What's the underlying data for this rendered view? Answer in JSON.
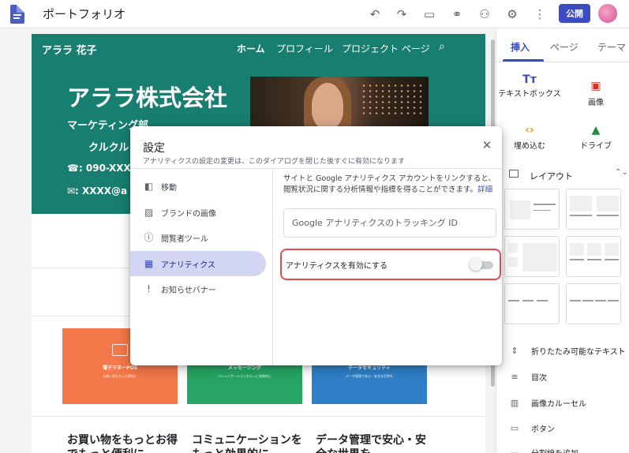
{
  "topbar": {
    "title": "ポートフォリオ",
    "icons": [
      "undo-icon",
      "redo-icon",
      "preview-icon",
      "link-icon",
      "share-icon",
      "gear-icon",
      "more-icon"
    ],
    "publish_label": "公開"
  },
  "site": {
    "name": "アララ 花子",
    "nav": [
      "ホーム",
      "プロフィール",
      "プロジェクト ページ"
    ],
    "company": "アララ株式会社",
    "department": "マーケティング部",
    "person": "クルクル",
    "tel": "☎: 090-XXX",
    "mail": "✉: XXXX@a",
    "cards": [
      {
        "title": "電子マネーPOS",
        "sub": "お買い物をもっと便利に"
      },
      {
        "title": "メッセージング",
        "sub": "コミュニケーションをもっと効果的に"
      },
      {
        "title": "データセキュリティ",
        "sub": "データ管理で安心・安全な世界を"
      }
    ],
    "card_headings": [
      "お買い物をもっとお得でもっと便利に",
      "コミュニケーションをもっと効果的に",
      "データ管理で安心・安全な世界を"
    ]
  },
  "right_panel": {
    "tabs": [
      "挿入",
      "ページ",
      "テーマ"
    ],
    "insert_items": [
      {
        "icon": "Tт",
        "label": "テキストボックス"
      },
      {
        "icon": "▣",
        "label": "画像"
      },
      {
        "icon": "‹›",
        "label": "埋め込む"
      },
      {
        "icon": "▲",
        "label": "ドライブ"
      }
    ],
    "layout_label": "レイアウト",
    "list_items": [
      {
        "icon": "⇕",
        "label": "折りたたみ可能なテキスト"
      },
      {
        "icon": "≡",
        "label": "目次"
      },
      {
        "icon": "▥",
        "label": "画像カルーセル"
      },
      {
        "icon": "▭",
        "label": "ボタン"
      },
      {
        "icon": "—",
        "label": "分割線を追加"
      }
    ]
  },
  "dialog": {
    "title": "設定",
    "subtitle": "アナリティクスの設定の変更は、このダイアログを閉じた後すぐに有効になります",
    "nav": [
      {
        "icon": "◧",
        "label": "移動"
      },
      {
        "icon": "▨",
        "label": "ブランドの画像"
      },
      {
        "icon": "ⓘ",
        "label": "閲覧者ツール"
      },
      {
        "icon": "▦",
        "label": "アナリティクス"
      },
      {
        "icon": "!",
        "label": "お知らせバナー"
      }
    ],
    "active_index": 3,
    "description": "サイトと Google アナリティクス アカウントをリンクすると、閲覧状況に関する分析情報や指標を得ることができます。",
    "description_link": "詳細",
    "tracking_placeholder": "Google アナリティクスのトラッキング ID",
    "tracking_value": "",
    "toggle_label": "アナリティクスを有効にする",
    "toggle_on": false
  }
}
